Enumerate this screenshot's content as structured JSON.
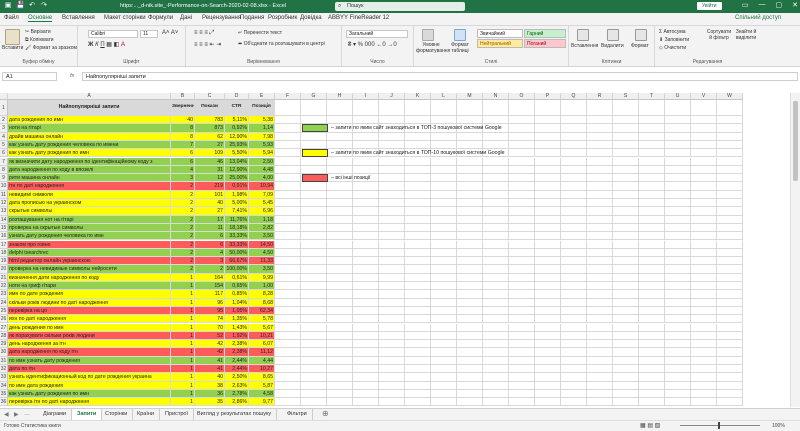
{
  "app": {
    "title": "https:..._d-nik.site_-Performance-on-Search-2020-02-08.xlsx  -  Excel",
    "search_placeholder": "Пошук",
    "signin": "Увійти",
    "share": "Спільний доступ"
  },
  "ribbon_tabs": [
    "Файл",
    "Основне",
    "Вставлення",
    "Макет сторінки",
    "Формули",
    "Дані",
    "Рецензування",
    "Подання",
    "Розробник",
    "Довідка",
    "ABBYY FineReader 12"
  ],
  "ribbon": {
    "paste": "Вставити",
    "cut": "Вирізати",
    "copy": "Копіювати",
    "format_painter": "Формат за зразком",
    "clipboard": "Буфер обміну",
    "font_name": "Calibri",
    "font_size": "11",
    "font": "Шрифт",
    "wrap": "Перенести текст",
    "merge": "Об'єднати та розташувати в центрі",
    "alignment": "Вирівнювання",
    "number_format": "Загальний",
    "number": "Число",
    "cond_format": "Умовне форматування",
    "format_table": "Формат таблиці",
    "style_normal": "Звичайний",
    "style_neutral": "Нейтральний",
    "style_good": "Гарний",
    "style_bad": "Поганий",
    "styles": "Стилі",
    "insert": "Вставлення",
    "delete": "Видалити",
    "format": "Формат",
    "cells": "Клітинки",
    "autosum": "Автосума",
    "fill": "Заповнити",
    "clear": "Очистити",
    "sort": "Сортувати й фільтр",
    "find": "Знайти й виділити",
    "editing": "Редагування"
  },
  "formula_bar": {
    "name_box": "A1",
    "formula": "Найпопулярніші запити"
  },
  "columns": [
    "A",
    "B",
    "C",
    "D",
    "E",
    "F",
    "G",
    "H",
    "I",
    "J",
    "K",
    "L",
    "M",
    "N",
    "O",
    "P",
    "Q",
    "R",
    "S",
    "T",
    "U",
    "V",
    "W"
  ],
  "table": {
    "headers": [
      "Найпопулярніші запити",
      "Звернення",
      "Покази",
      "CTR",
      "Позиція"
    ],
    "rows": [
      {
        "q": "дата рождения по имн",
        "c": "40",
        "i": "783",
        "ctr": "5,11%",
        "p": "5,38",
        "color": "yellow"
      },
      {
        "q": "ноти на гітарі",
        "c": "8",
        "i": "873",
        "ctr": "0,92%",
        "p": "1,14",
        "color": "green"
      },
      {
        "q": "драйв машина онлайн",
        "c": "8",
        "i": "62",
        "ctr": "12,90%",
        "p": "7,98",
        "color": "yellow"
      },
      {
        "q": "как узнать дату рождения человека по имени",
        "c": "7",
        "i": "27",
        "ctr": "25,93%",
        "p": "5,93",
        "color": "green"
      },
      {
        "q": "как узнать дату рождения по имн",
        "c": "6",
        "i": "109",
        "ctr": "5,50%",
        "p": "5,94",
        "color": "yellow"
      },
      {
        "q": "як визначити дату народження по ідентифікаційному коду з",
        "c": "6",
        "i": "46",
        "ctr": "13,04%",
        "p": "2,50",
        "color": "green"
      },
      {
        "q": "дата народження по коду в впозелі",
        "c": "4",
        "i": "31",
        "ctr": "12,90%",
        "p": "4,48",
        "color": "green"
      },
      {
        "q": "рити машина онлайн",
        "c": "3",
        "i": "12",
        "ctr": "25,00%",
        "p": "4,00",
        "color": "green"
      },
      {
        "q": "ітн по даті народження",
        "c": "2",
        "i": "219",
        "ctr": "0,91%",
        "p": "10,94",
        "color": "red"
      },
      {
        "q": "невидимі символи",
        "c": "2",
        "i": "101",
        "ctr": "1,98%",
        "p": "7,09",
        "color": "yellow"
      },
      {
        "q": "дата прописью на украинском",
        "c": "2",
        "i": "40",
        "ctr": "5,00%",
        "p": "5,45",
        "color": "yellow"
      },
      {
        "q": "скрытые символы",
        "c": "2",
        "i": "27",
        "ctr": "7,41%",
        "p": "6,96",
        "color": "yellow"
      },
      {
        "q": "розташування нот на гітарі",
        "c": "2",
        "i": "17",
        "ctr": "11,76%",
        "p": "1,18",
        "color": "green"
      },
      {
        "q": "проверка на скрытые символы",
        "c": "2",
        "i": "11",
        "ctr": "18,18%",
        "p": "2,82",
        "color": "green"
      },
      {
        "q": "узнать дату рождения человека по имн",
        "c": "2",
        "i": "6",
        "ctr": "33,33%",
        "p": "3,50",
        "color": "green"
      },
      {
        "q": "знаком про говно",
        "c": "2",
        "i": "6",
        "ctr": "33,33%",
        "p": "14,50",
        "color": "red"
      },
      {
        "q": "delphi tsearchrec",
        "c": "2",
        "i": "4",
        "ctr": "50,00%",
        "p": "4,50",
        "color": "green"
      },
      {
        "q": "html редактор онлайн украинскою",
        "c": "2",
        "i": "3",
        "ctr": "66,67%",
        "p": "11,33",
        "color": "red"
      },
      {
        "q": "проверка на невидимые символы нейросети",
        "c": "2",
        "i": "2",
        "ctr": "100,00%",
        "p": "3,50",
        "color": "green"
      },
      {
        "q": "визначення дати народження по коду",
        "c": "1",
        "i": "164",
        "ctr": "0,61%",
        "p": "9,99",
        "color": "yellow"
      },
      {
        "q": "ноти на гриф гітари",
        "c": "1",
        "i": "154",
        "ctr": "0,65%",
        "p": "1,00",
        "color": "green"
      },
      {
        "q": "имн по дате рождения",
        "c": "1",
        "i": "117",
        "ctr": "0,85%",
        "p": "8,28",
        "color": "yellow"
      },
      {
        "q": "скільки років людини по даті народження",
        "c": "1",
        "i": "96",
        "ctr": "1,04%",
        "p": "8,68",
        "color": "yellow"
      },
      {
        "q": "перевірка на цо",
        "c": "1",
        "i": "95",
        "ctr": "1,05%",
        "p": "62,34",
        "color": "red"
      },
      {
        "q": "ихн по даті народження",
        "c": "1",
        "i": "74",
        "ctr": "1,35%",
        "p": "5,78",
        "color": "yellow"
      },
      {
        "q": "день рождения по имн",
        "c": "1",
        "i": "70",
        "ctr": "1,43%",
        "p": "5,67",
        "color": "yellow"
      },
      {
        "q": "як порахувати скільки років людини",
        "c": "1",
        "i": "52",
        "ctr": "1,92%",
        "p": "10,21",
        "color": "red"
      },
      {
        "q": "день народження за ітн",
        "c": "1",
        "i": "42",
        "ctr": "2,38%",
        "p": "6,07",
        "color": "yellow"
      },
      {
        "q": "дата народження по коду ітн",
        "c": "1",
        "i": "42",
        "ctr": "2,38%",
        "p": "11,12",
        "color": "red"
      },
      {
        "q": "по имн узнать дату рождения",
        "c": "1",
        "i": "41",
        "ctr": "2,44%",
        "p": "4,44",
        "color": "green"
      },
      {
        "q": "дата по ітн",
        "c": "1",
        "i": "41",
        "ctr": "2,44%",
        "p": "10,27",
        "color": "red"
      },
      {
        "q": "узнать идентификационный код по дате рождения украина",
        "c": "1",
        "i": "40",
        "ctr": "2,50%",
        "p": "8,65",
        "color": "yellow"
      },
      {
        "q": "по имн дата рождения",
        "c": "1",
        "i": "38",
        "ctr": "2,63%",
        "p": "5,87",
        "color": "yellow"
      },
      {
        "q": "как узнать дату рождения по имн",
        "c": "1",
        "i": "36",
        "ctr": "2,78%",
        "p": "4,58",
        "color": "green"
      },
      {
        "q": "перевірка ітн по даті народження",
        "c": "1",
        "i": "35",
        "ctr": "2,86%",
        "p": "9,77",
        "color": "yellow"
      }
    ]
  },
  "legend": [
    {
      "color": "#92d050",
      "text": "– запити по яким сайт знаходиться в ТОП-3 пошукової системи Google"
    },
    {
      "color": "#ffff00",
      "text": "– запити по яким сайт знаходиться в ТОП-10 пошукової системи Google"
    },
    {
      "color": "#ff5b5b",
      "text": "– всі інші позиції"
    }
  ],
  "sheet_tabs": [
    "Діаграми",
    "Запити",
    "Сторінки",
    "Країни",
    "Пристрої",
    "Вигляд у результатах пошуку",
    "Фільтри"
  ],
  "active_sheet": "Запити",
  "status": {
    "left": "Готово   Статистика книги",
    "zoom": "100%"
  }
}
